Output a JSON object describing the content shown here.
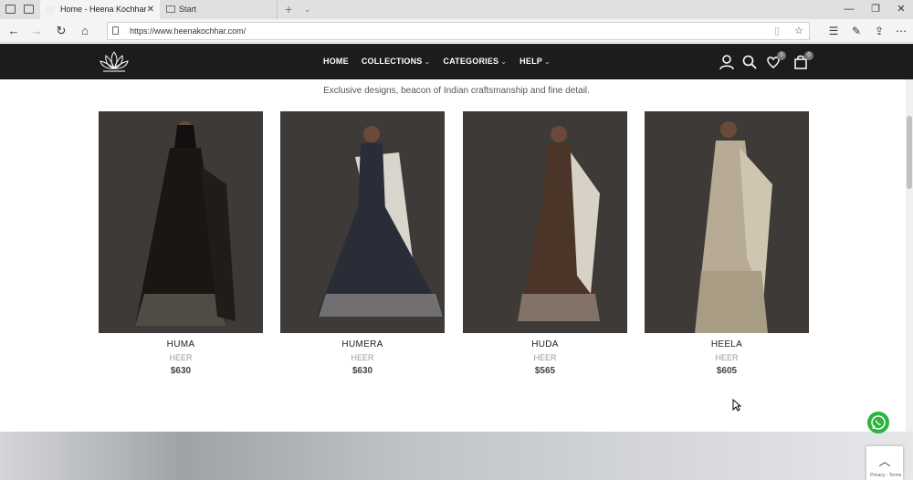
{
  "browser": {
    "tabs": [
      {
        "title": "Home - Heena Kochhar",
        "active": true
      },
      {
        "title": "Start",
        "active": false
      }
    ],
    "address": "https://www.heenakochhar.com/"
  },
  "header": {
    "menu": [
      {
        "label": "HOME",
        "has_dropdown": false
      },
      {
        "label": "COLLECTIONS",
        "has_dropdown": true
      },
      {
        "label": "CATEGORIES",
        "has_dropdown": true
      },
      {
        "label": "HELP",
        "has_dropdown": true
      }
    ],
    "wishlist_count": "0",
    "cart_count": "0"
  },
  "tagline": "Exclusive designs, beacon of Indian craftsmanship and fine detail.",
  "products": [
    {
      "name": "HUMA",
      "collection": "HEER",
      "price": "$630",
      "garment_color": "#1a1614"
    },
    {
      "name": "HUMERA",
      "collection": "HEER",
      "price": "$630",
      "garment_color": "#2a2d38"
    },
    {
      "name": "HUDA",
      "collection": "HEER",
      "price": "$565",
      "garment_color": "#4b3428"
    },
    {
      "name": "HEELA",
      "collection": "HEER",
      "price": "$605",
      "garment_color": "#b7ab95"
    }
  ],
  "floating": {
    "recaptcha_text": "Privacy - Terms"
  },
  "colors": {
    "header_bg": "#1c1c1c",
    "whatsapp": "#2ab53f"
  }
}
